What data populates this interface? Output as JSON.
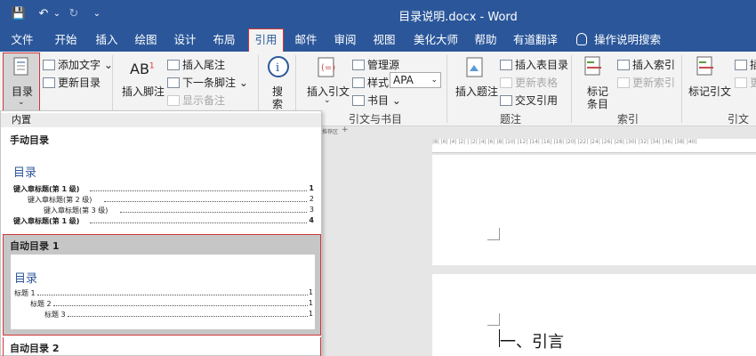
{
  "window": {
    "title": "目录说明.docx  -  Word"
  },
  "quick_access": {
    "save": "💾",
    "undo": "↶",
    "undo_arrow": "⌄",
    "redo": "↻",
    "customize": "⌄"
  },
  "tabs": [
    "文件",
    "开始",
    "插入",
    "绘图",
    "设计",
    "布局",
    "引用",
    "邮件",
    "审阅",
    "视图",
    "美化大师",
    "帮助",
    "有道翻译"
  ],
  "active_tab": "引用",
  "tell_me": "操作说明搜索",
  "ribbon": {
    "toc": {
      "label": "目录",
      "arrow": "⌄"
    },
    "toc_group": {
      "add_text": "添加文字",
      "add_text_arrow": "⌄",
      "update_toc": "更新目录"
    },
    "footnotes": {
      "insert_footnote": "插入脚注",
      "ab_glyph": "AB",
      "ab_sup": "1",
      "insert_endnote": "插入尾注",
      "next_footnote": "下一条脚注",
      "next_arrow": "⌄",
      "show_notes": "显示备注"
    },
    "search": {
      "label_line1": "搜",
      "label_line2": "索"
    },
    "citations": {
      "insert_citation": "插入引文",
      "insert_arrow": "⌄",
      "manage_sources": "管理源",
      "style_label": "样式:",
      "style_value": "APA",
      "style_arrow": "⌄",
      "bibliography": "书目",
      "bib_arrow": "⌄",
      "group_label": "引文与书目"
    },
    "captions": {
      "insert_caption": "插入题注",
      "insert_table_of_figures": "插入表目录",
      "update_table": "更新表格",
      "cross_reference": "交叉引用",
      "group_label": "题注"
    },
    "index": {
      "mark_entry_line1": "标记",
      "mark_entry_line2": "条目",
      "insert_index": "插入索引",
      "update_index": "更新索引",
      "group_label": "索引"
    },
    "toa": {
      "mark_citation": "标记引文",
      "insert_partial": "插",
      "update_partial": "更",
      "group_label": "引文目"
    }
  },
  "gallery": {
    "builtin_header": "内置",
    "manual": {
      "name": "手动目录",
      "title": "目录",
      "lines": [
        {
          "text": "键入章标题(第 1 级)",
          "page": "1",
          "level": 1
        },
        {
          "text": "键入章标题(第 2 级)",
          "page": "2",
          "level": 2
        },
        {
          "text": "键入章标题(第 3 级)",
          "page": "3",
          "level": 3
        },
        {
          "text": "键入章标题(第 1 级)",
          "page": "4",
          "level": 1
        }
      ]
    },
    "auto1": {
      "name": "自动目录 1",
      "title": "目录",
      "lines": [
        {
          "text": "标题 1",
          "page": "1",
          "level": 1
        },
        {
          "text": "标题 2",
          "page": "1",
          "level": 2
        },
        {
          "text": "标题 3",
          "page": "1",
          "level": 3
        }
      ]
    },
    "auto2": {
      "name": "自动目录 2"
    }
  },
  "document": {
    "nav_pane": "推荐区",
    "plus": "+",
    "ruler_text": "|8| |6| |4| |2| | |2| |4| |6| |8| |10| |12| |14| |16| |18| |20| |22| |24| |26| |28| |30| |32| |34| |36| |38| |40|",
    "heading": "一、引言"
  },
  "colors": {
    "title_bar": "#2b579a",
    "highlight": "#d0383a",
    "toc_title": "#2f5597"
  }
}
